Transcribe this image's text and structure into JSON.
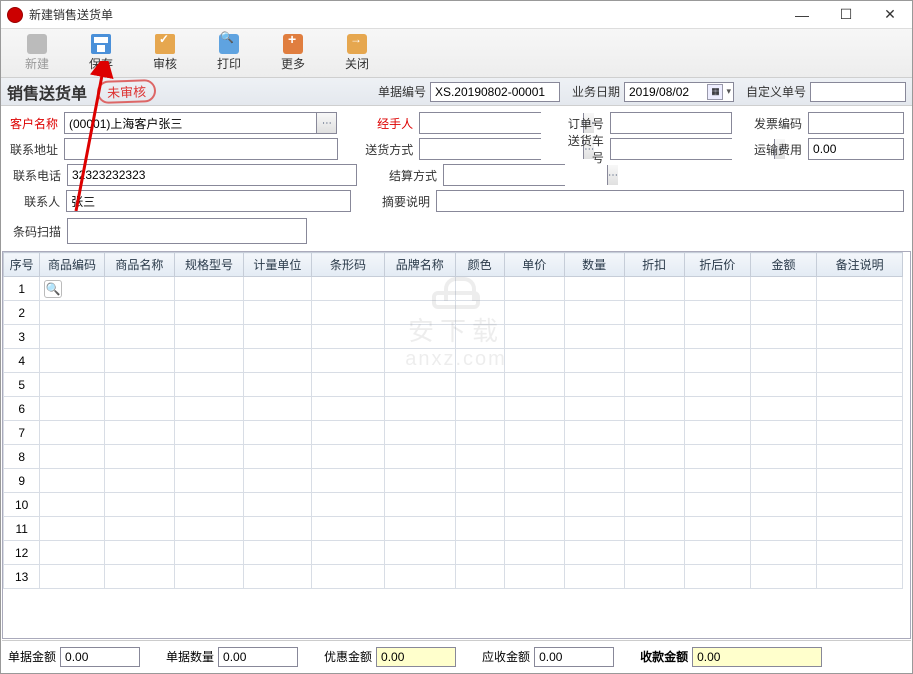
{
  "window": {
    "title": "新建销售送货单"
  },
  "toolbar": {
    "new": "新建",
    "save": "保存",
    "audit": "审核",
    "print": "打印",
    "more": "更多",
    "close": "关闭"
  },
  "header": {
    "form_title": "销售送货单",
    "stamp": "未审核",
    "doc_no_label": "单据编号",
    "doc_no": "XS.20190802-00001",
    "biz_date_label": "业务日期",
    "biz_date": "2019/08/02",
    "custom_no_label": "自定义单号",
    "custom_no": ""
  },
  "form": {
    "customer_label": "客户名称",
    "customer": "(00001)上海客户张三",
    "handler_label": "经手人",
    "handler": "",
    "order_no_label": "订单号",
    "order_no": "",
    "invoice_no_label": "发票编码",
    "invoice_no": "",
    "address_label": "联系地址",
    "address": "",
    "ship_mode_label": "送货方式",
    "ship_mode": "",
    "vehicle_label": "送货车号",
    "vehicle": "",
    "freight_label": "运输费用",
    "freight": "0.00",
    "phone_label": "联系电话",
    "phone": "32323232323",
    "settle_label": "结算方式",
    "settle": "",
    "contact_label": "联系人",
    "contact": "张三",
    "summary_label": "摘要说明",
    "summary": "",
    "barcode_label": "条码扫描",
    "barcode": ""
  },
  "table": {
    "columns": [
      "序号",
      "商品编码",
      "商品名称",
      "规格型号",
      "计量单位",
      "条形码",
      "品牌名称",
      "颜色",
      "单价",
      "数量",
      "折扣",
      "折后价",
      "金额",
      "备注说明"
    ],
    "row_count": 13
  },
  "footer": {
    "amount_label": "单据金额",
    "amount": "0.00",
    "qty_label": "单据数量",
    "qty": "0.00",
    "discount_label": "优惠金额",
    "discount": "0.00",
    "receivable_label": "应收金额",
    "receivable": "0.00",
    "received_label": "收款金额",
    "received": "0.00"
  },
  "watermark": {
    "line1": "安下载",
    "line2": "anxz.com"
  }
}
